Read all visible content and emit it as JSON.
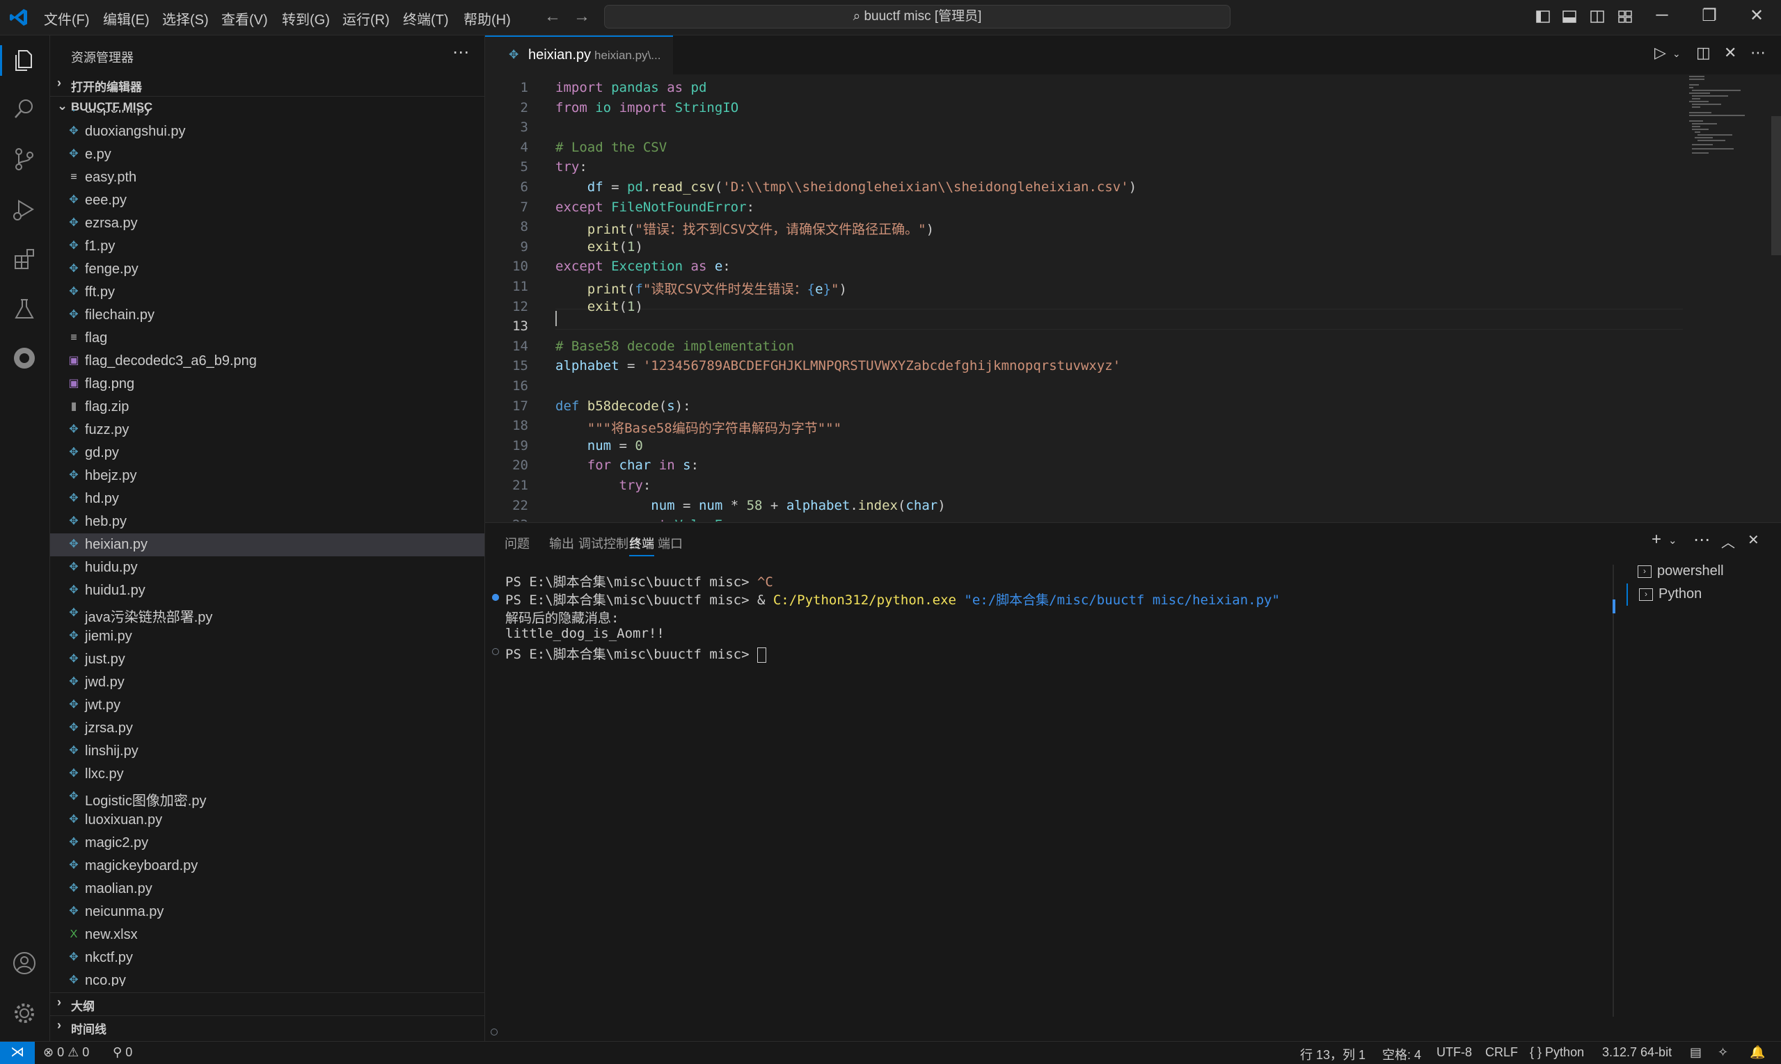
{
  "menu": [
    "文件(F)",
    "编辑(E)",
    "选择(S)",
    "查看(V)",
    "转到(G)",
    "运行(R)",
    "终端(T)",
    "帮助(H)"
  ],
  "search": {
    "label": "buuctf misc [管理员]"
  },
  "sidebar": {
    "title": "资源管理器",
    "open_editors": "打开的编辑器",
    "folder": "BUUCTF MISC",
    "outline": "大纲",
    "timeline": "时间线",
    "files": [
      {
        "name": "dispoint.py",
        "type": "py"
      },
      {
        "name": "duoxiangshui.py",
        "type": "py"
      },
      {
        "name": "e.py",
        "type": "py"
      },
      {
        "name": "easy.pth",
        "type": "txt"
      },
      {
        "name": "eee.py",
        "type": "py"
      },
      {
        "name": "ezrsa.py",
        "type": "py"
      },
      {
        "name": "f1.py",
        "type": "py"
      },
      {
        "name": "fenge.py",
        "type": "py"
      },
      {
        "name": "fft.py",
        "type": "py"
      },
      {
        "name": "filechain.py",
        "type": "py"
      },
      {
        "name": "flag",
        "type": "txt"
      },
      {
        "name": "flag_decodedc3_a6_b9.png",
        "type": "img"
      },
      {
        "name": "flag.png",
        "type": "img"
      },
      {
        "name": "flag.zip",
        "type": "zip"
      },
      {
        "name": "fuzz.py",
        "type": "py"
      },
      {
        "name": "gd.py",
        "type": "py"
      },
      {
        "name": "hbejz.py",
        "type": "py"
      },
      {
        "name": "hd.py",
        "type": "py"
      },
      {
        "name": "heb.py",
        "type": "py"
      },
      {
        "name": "heixian.py",
        "type": "py",
        "active": true
      },
      {
        "name": "huidu.py",
        "type": "py"
      },
      {
        "name": "huidu1.py",
        "type": "py"
      },
      {
        "name": "java污染链热部署.py",
        "type": "py"
      },
      {
        "name": "jiemi.py",
        "type": "py"
      },
      {
        "name": "just.py",
        "type": "py"
      },
      {
        "name": "jwd.py",
        "type": "py"
      },
      {
        "name": "jwt.py",
        "type": "py"
      },
      {
        "name": "jzrsa.py",
        "type": "py"
      },
      {
        "name": "linshij.py",
        "type": "py"
      },
      {
        "name": "llxc.py",
        "type": "py"
      },
      {
        "name": "Logistic图像加密.py",
        "type": "py"
      },
      {
        "name": "luoxixuan.py",
        "type": "py"
      },
      {
        "name": "magic2.py",
        "type": "py"
      },
      {
        "name": "magickeyboard.py",
        "type": "py"
      },
      {
        "name": "maolian.py",
        "type": "py"
      },
      {
        "name": "neicunma.py",
        "type": "py"
      },
      {
        "name": "new.xlsx",
        "type": "xlsx"
      },
      {
        "name": "nkctf.py",
        "type": "py"
      },
      {
        "name": "nco.py",
        "type": "py"
      }
    ]
  },
  "editor": {
    "tab_name": "heixian.py",
    "tab_desc": "heixian.py\\...",
    "current_line": 13,
    "lines": [
      [
        [
          "kw",
          "import"
        ],
        [
          "t",
          " "
        ],
        [
          "cls",
          "pandas"
        ],
        [
          "t",
          " "
        ],
        [
          "kw",
          "as"
        ],
        [
          "t",
          " "
        ],
        [
          "cls",
          "pd"
        ]
      ],
      [
        [
          "kw",
          "from"
        ],
        [
          "t",
          " "
        ],
        [
          "cls",
          "io"
        ],
        [
          "t",
          " "
        ],
        [
          "kw",
          "import"
        ],
        [
          "t",
          " "
        ],
        [
          "cls",
          "StringIO"
        ]
      ],
      [],
      [
        [
          "cm",
          "# Load the CSV"
        ]
      ],
      [
        [
          "kw",
          "try"
        ],
        [
          "t",
          ":"
        ]
      ],
      [
        [
          "t",
          "    "
        ],
        [
          "var",
          "df"
        ],
        [
          "t",
          " = "
        ],
        [
          "cls",
          "pd"
        ],
        [
          "t",
          "."
        ],
        [
          "fn",
          "read_csv"
        ],
        [
          "t",
          "("
        ],
        [
          "str",
          "'D:\\\\tmp\\\\sheidongleheixian\\\\sheidongleheixian.csv'"
        ],
        [
          "t",
          ")"
        ]
      ],
      [
        [
          "kw",
          "except"
        ],
        [
          "t",
          " "
        ],
        [
          "cls",
          "FileNotFoundError"
        ],
        [
          "t",
          ":"
        ]
      ],
      [
        [
          "t",
          "    "
        ],
        [
          "fn",
          "print"
        ],
        [
          "t",
          "("
        ],
        [
          "str",
          "\"错误：找不到CSV文件，请确保文件路径正确。\""
        ],
        [
          "t",
          ")"
        ]
      ],
      [
        [
          "t",
          "    "
        ],
        [
          "fn",
          "exit"
        ],
        [
          "t",
          "("
        ],
        [
          "num",
          "1"
        ],
        [
          "t",
          ")"
        ]
      ],
      [
        [
          "kw",
          "except"
        ],
        [
          "t",
          " "
        ],
        [
          "cls",
          "Exception"
        ],
        [
          "t",
          " "
        ],
        [
          "kw",
          "as"
        ],
        [
          "t",
          " "
        ],
        [
          "var",
          "e"
        ],
        [
          "t",
          ":"
        ]
      ],
      [
        [
          "t",
          "    "
        ],
        [
          "fn",
          "print"
        ],
        [
          "t",
          "("
        ],
        [
          "kw2",
          "f"
        ],
        [
          "str",
          "\"读取CSV文件时发生错误："
        ],
        [
          "kw2",
          "{"
        ],
        [
          "var",
          "e"
        ],
        [
          "kw2",
          "}"
        ],
        [
          "str",
          "\""
        ],
        [
          "t",
          ")"
        ]
      ],
      [
        [
          "t",
          "    "
        ],
        [
          "fn",
          "exit"
        ],
        [
          "t",
          "("
        ],
        [
          "num",
          "1"
        ],
        [
          "t",
          ")"
        ]
      ],
      [],
      [
        [
          "cm",
          "# Base58 decode implementation"
        ]
      ],
      [
        [
          "var",
          "alphabet"
        ],
        [
          "t",
          " = "
        ],
        [
          "str",
          "'123456789ABCDEFGHJKLMNPQRSTUVWXYZabcdefghijkmnopqrstuvwxyz'"
        ]
      ],
      [],
      [
        [
          "kw2",
          "def"
        ],
        [
          "t",
          " "
        ],
        [
          "fn",
          "b58decode"
        ],
        [
          "t",
          "("
        ],
        [
          "var",
          "s"
        ],
        [
          "t",
          "):"
        ]
      ],
      [
        [
          "t",
          "    "
        ],
        [
          "str",
          "\"\"\"将Base58编码的字符串解码为字节\"\"\""
        ]
      ],
      [
        [
          "t",
          "    "
        ],
        [
          "var",
          "num"
        ],
        [
          "t",
          " = "
        ],
        [
          "num",
          "0"
        ]
      ],
      [
        [
          "t",
          "    "
        ],
        [
          "kw",
          "for"
        ],
        [
          "t",
          " "
        ],
        [
          "var",
          "char"
        ],
        [
          "t",
          " "
        ],
        [
          "kw",
          "in"
        ],
        [
          "t",
          " "
        ],
        [
          "var",
          "s"
        ],
        [
          "t",
          ":"
        ]
      ],
      [
        [
          "t",
          "        "
        ],
        [
          "kw",
          "try"
        ],
        [
          "t",
          ":"
        ]
      ],
      [
        [
          "t",
          "            "
        ],
        [
          "var",
          "num"
        ],
        [
          "t",
          " = "
        ],
        [
          "var",
          "num"
        ],
        [
          "t",
          " * "
        ],
        [
          "num",
          "58"
        ],
        [
          "t",
          " + "
        ],
        [
          "var",
          "alphabet"
        ],
        [
          "t",
          "."
        ],
        [
          "fn",
          "index"
        ],
        [
          "t",
          "("
        ],
        [
          "var",
          "char"
        ],
        [
          "t",
          ")"
        ]
      ],
      [
        [
          "t",
          "        "
        ],
        [
          "kw",
          "except"
        ],
        [
          "t",
          " "
        ],
        [
          "cls",
          "ValueError"
        ],
        [
          "t",
          ":"
        ]
      ]
    ]
  },
  "panel": {
    "tabs": [
      "问题",
      "输出",
      "调试控制台",
      "终端",
      "端口"
    ],
    "active_tab": "终端",
    "terminal": {
      "line1_prompt": "PS E:\\脚本合集\\misc\\buuctf misc> ",
      "line1_cmd": "^C",
      "line2_prompt": "PS E:\\脚本合集\\misc\\buuctf misc> & ",
      "line2_exe": "C:/Python312/python.exe",
      "line2_arg": "\"e:/脚本合集/misc/buuctf misc/heixian.py\"",
      "line3": "解码后的隐藏消息:",
      "line4": "little_dog_is_Aomr!!",
      "line5_prompt": "PS E:\\脚本合集\\misc\\buuctf misc> "
    },
    "terminals": [
      "powershell",
      "Python"
    ]
  },
  "statusbar": {
    "errors": "0",
    "warnings": "0",
    "ports": "0",
    "position": "行 13，列 1",
    "spaces": "空格: 4",
    "encoding": "UTF-8",
    "eol": "CRLF",
    "language": "Python",
    "interpreter": "3.12.7 64-bit"
  },
  "colors": {
    "accent": "#0078d4",
    "python_icon": "#519aba",
    "excel_icon": "#4caf50"
  }
}
